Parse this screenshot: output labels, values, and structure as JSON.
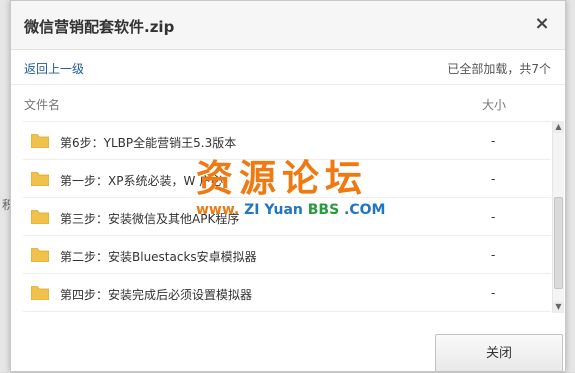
{
  "backdrop": {
    "left_mark": "积",
    "right_mark": ""
  },
  "dialog": {
    "title": "微信营销配套软件.zip",
    "close_glyph": "×"
  },
  "nav": {
    "back_label": "返回上一级",
    "status": "已全部加载，共7个"
  },
  "table": {
    "col_name": "文件名",
    "col_size": "大小",
    "rows": [
      {
        "name": "第6步：YLBP全能营销王5.3版本",
        "size": "-"
      },
      {
        "name": "第一步：XP系统必装，W  户必",
        "size": "-"
      },
      {
        "name": "第三步：安装微信及其他APK程序",
        "size": "-"
      },
      {
        "name": "第二步：安装Bluestacks安卓模拟器",
        "size": "-"
      },
      {
        "name": "第四步：安装完成后必须设置模拟器",
        "size": "-"
      }
    ]
  },
  "scroll": {
    "up_glyph": "▲",
    "down_glyph": "▼"
  },
  "footer": {
    "close_label": "关闭"
  },
  "watermark": {
    "big": "资源论坛",
    "www": "www.",
    "zi": "ZI",
    "yuan": "Yuan",
    "bbs": "BBS",
    "com": ".COM"
  },
  "colors": {
    "link": "#1f5c99",
    "folder": "#f0c14b",
    "watermark_orange": "#f07a12",
    "watermark_blue": "#1f76c3",
    "watermark_green": "#2a9a3e"
  }
}
